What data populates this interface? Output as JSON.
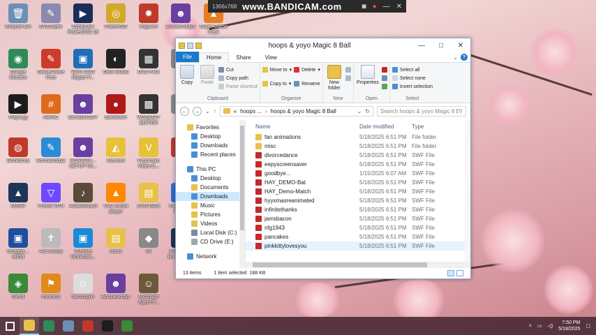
{
  "desktop": {
    "icons": [
      {
        "label": "Recycle Bin",
        "color": "#6b8fb5",
        "glyph": "🗑"
      },
      {
        "label": "DVDStyler",
        "color": "#8a8ab0",
        "glyph": "✎"
      },
      {
        "label": "CyberLink PowerDVD 18",
        "color": "#1b2d5b",
        "glyph": "▶"
      },
      {
        "label": "PowerISO",
        "color": "#d4a82a",
        "glyph": "◎"
      },
      {
        "label": "ImgBurn",
        "color": "#c0392b",
        "glyph": "✹"
      },
      {
        "label": "BonziBuddy3",
        "color": "#6a3fa0",
        "glyph": "☻"
      },
      {
        "label": "Super Game Pack",
        "color": "#e67e22",
        "glyph": "▲"
      },
      {
        "label": "Google Chrome",
        "color": "#2e8b57",
        "glyph": "◉"
      },
      {
        "label": "GameAware Free",
        "color": "#cc3b2b",
        "glyph": "✎"
      },
      {
        "label": "WinX DVD Ripper P...",
        "color": "#1e6fb8",
        "glyph": "▣"
      },
      {
        "label": "OBS Studio",
        "color": "#222",
        "glyph": "◐"
      },
      {
        "label": "DVD Flick",
        "color": "#333",
        "glyph": "▦"
      },
      {
        "label": "Flip",
        "color": "#888",
        "glyph": "◆"
      },
      {
        "label": "Playit.gg",
        "color": "#1c1c1c",
        "glyph": "▶"
      },
      {
        "label": "AdiIRC",
        "color": "#e06a1b",
        "glyph": "#"
      },
      {
        "label": "BonziBUDDY",
        "color": "#6a3fa0",
        "glyph": "☻"
      },
      {
        "label": "Bandicam",
        "color": "#b01818",
        "glyph": "●"
      },
      {
        "label": "WSQEDIT EDITOR",
        "color": "#333",
        "glyph": "▩"
      },
      {
        "label": "Idk",
        "color": "#888",
        "glyph": "◆"
      },
      {
        "label": "Bibbiiboby",
        "color": "#c0392b",
        "glyph": "◍"
      },
      {
        "label": "BonziBuddy2",
        "color": "#2c8bd6",
        "glyph": "✎"
      },
      {
        "label": "BONZIBU... SETUP WI...",
        "color": "#6a3fa0",
        "glyph": "☻"
      },
      {
        "label": "Maxwell",
        "color": "#e6c23a",
        "glyph": "◭"
      },
      {
        "label": "Freemake Video C...",
        "color": "#e6c23a",
        "glyph": "V"
      },
      {
        "label": "Mi...",
        "color": "#c0392b",
        "glyph": "■"
      },
      {
        "label": "MSSH",
        "color": "#1d3557",
        "glyph": "▲"
      },
      {
        "label": "Proton VPN",
        "color": "#6d4aff",
        "glyph": "▽"
      },
      {
        "label": "AudioWizard",
        "color": "#5a4a3a",
        "glyph": "♪"
      },
      {
        "label": "VLC media player",
        "color": "#ff8800",
        "glyph": "▲"
      },
      {
        "label": "DVD ISOs",
        "color": "#e8c14a",
        "glyph": "▤"
      },
      {
        "label": "Intellectual Player",
        "color": "#2c6fd6",
        "glyph": "▲"
      },
      {
        "label": "scrappa…tell5d",
        "color": "#1e4f9e",
        "glyph": "▣"
      },
      {
        "label": "Ace Buddy",
        "color": "#bbb",
        "glyph": "✝"
      },
      {
        "label": "VMware Workstati...",
        "color": "#1a8ad6",
        "glyph": "▣"
      },
      {
        "label": "chars",
        "color": "#e8c14a",
        "glyph": "▤"
      },
      {
        "label": "Mi",
        "color": "#888",
        "glyph": "◆"
      },
      {
        "label": "Ashampoo Burning S...",
        "color": "#1d3557",
        "glyph": "◉"
      },
      {
        "label": "blend",
        "color": "#3a8a3a",
        "glyph": "◈"
      },
      {
        "label": "minetest",
        "color": "#e08a1b",
        "glyph": "⚑"
      },
      {
        "label": "decompile",
        "color": "#ddd",
        "glyph": "☺"
      },
      {
        "label": "BonziBuddy1",
        "color": "#6a3fa0",
        "glyph": "☻"
      },
      {
        "label": "Microsoft Agent P...",
        "color": "#6b5a3a",
        "glyph": "☺"
      }
    ]
  },
  "bandicam": {
    "resolution": "1366x768",
    "brand": "www.BANDICAM.com",
    "controls": [
      "camera-icon",
      "record-icon",
      "minimize-icon",
      "close-icon"
    ]
  },
  "explorer": {
    "title": "hoops & yoyo Magic 8 Ball",
    "window_buttons": {
      "minimize": "—",
      "maximize": "□",
      "close": "✕"
    },
    "tabs": [
      {
        "label": "File",
        "style": "file"
      },
      {
        "label": "Home",
        "style": "active"
      },
      {
        "label": "Share",
        "style": ""
      },
      {
        "label": "View",
        "style": ""
      }
    ],
    "help_label": "?",
    "ribbon": {
      "clipboard": {
        "name": "Clipboard",
        "copy": "Copy",
        "paste": "Paste",
        "cut": "Cut",
        "copy_path": "Copy path",
        "paste_shortcut": "Paste shortcut"
      },
      "organize": {
        "name": "Organize",
        "move_to": "Move to",
        "copy_to": "Copy to",
        "delete": "Delete",
        "rename": "Rename"
      },
      "new": {
        "name": "New",
        "new_folder": "New folder"
      },
      "open": {
        "name": "Open",
        "properties": "Properties"
      },
      "select": {
        "name": "Select",
        "select_all": "Select all",
        "select_none": "Select none",
        "invert_selection": "Invert selection"
      }
    },
    "address": {
      "prefix": "«",
      "crumbs": [
        "hoops ...",
        "hoops & yoyo Magic 8 Ball"
      ],
      "search_placeholder": "Search hoops & yoyo Magic 8 Ball"
    },
    "navpane": {
      "quick_access": [
        {
          "label": "Favorites",
          "icon": "star-icon",
          "color": "#e8c14a"
        },
        {
          "label": "Desktop",
          "icon": "desktop-icon",
          "color": "#4a8fd6"
        },
        {
          "label": "Downloads",
          "icon": "downloads-icon",
          "color": "#4a8fd6"
        },
        {
          "label": "Recent places",
          "icon": "recent-icon",
          "color": "#4a8fd6"
        }
      ],
      "this_pc": [
        {
          "label": "This PC",
          "icon": "computer-icon",
          "color": "#4a8fd6"
        },
        {
          "label": "Desktop",
          "icon": "desktop-icon",
          "color": "#4a8fd6"
        },
        {
          "label": "Documents",
          "icon": "documents-icon",
          "color": "#e8c14a"
        },
        {
          "label": "Downloads",
          "icon": "downloads-icon",
          "color": "#4a8fd6"
        },
        {
          "label": "Music",
          "icon": "music-icon",
          "color": "#e8c14a"
        },
        {
          "label": "Pictures",
          "icon": "pictures-icon",
          "color": "#e8c14a"
        },
        {
          "label": "Videos",
          "icon": "videos-icon",
          "color": "#e8c14a"
        },
        {
          "label": "Local Disk (C:)",
          "icon": "disk-icon",
          "color": "#7a8a9a"
        },
        {
          "label": "CD Drive (E:)",
          "icon": "cd-drive-icon",
          "color": "#9aa"
        }
      ],
      "network": {
        "label": "Network",
        "icon": "network-icon",
        "color": "#4a8fd6"
      }
    },
    "columns": {
      "name": "Name",
      "date": "Date modified",
      "type": "Type"
    },
    "files": [
      {
        "name": "fan animations",
        "date": "5/18/2025 6:51 PM",
        "type": "File folder",
        "kind": "folder"
      },
      {
        "name": "misc",
        "date": "5/18/2025 6:51 PM",
        "type": "File folder",
        "kind": "folder"
      },
      {
        "name": "divorcedance",
        "date": "5/18/2025 6:51 PM",
        "type": "SWF File",
        "kind": "swf"
      },
      {
        "name": "eepyscreensaver",
        "date": "5/18/2025 6:51 PM",
        "type": "SWF File",
        "kind": "swf"
      },
      {
        "name": "goodbye...",
        "date": "1/15/2025 6:07 AM",
        "type": "SWF File",
        "kind": "swf"
      },
      {
        "name": "HAY_DEMO-Bat",
        "date": "5/18/2025 6:51 PM",
        "type": "SWF File",
        "kind": "swf"
      },
      {
        "name": "HAY_Demo-Match",
        "date": "5/18/2025 6:51 PM",
        "type": "SWF File",
        "kind": "swf"
      },
      {
        "name": "hyyxmasreanimated",
        "date": "5/18/2025 6:51 PM",
        "type": "SWF File",
        "kind": "swf"
      },
      {
        "name": "infinitethanks",
        "date": "5/18/2025 6:51 PM",
        "type": "SWF File",
        "kind": "swf"
      },
      {
        "name": "jamsbacon",
        "date": "5/18/2025 6:51 PM",
        "type": "SWF File",
        "kind": "swf"
      },
      {
        "name": "nfg1943",
        "date": "5/18/2025 6:51 PM",
        "type": "SWF File",
        "kind": "swf"
      },
      {
        "name": "pancakes",
        "date": "5/18/2025 6:51 PM",
        "type": "SWF File",
        "kind": "swf"
      },
      {
        "name": "pinkkittylovesyou",
        "date": "5/18/2025 6:51 PM",
        "type": "SWF File",
        "kind": "swf",
        "selected": true
      }
    ],
    "status": {
      "count": "13 items",
      "selection": "1 item selected",
      "size": "188 KB"
    }
  },
  "taskbar": {
    "icons": [
      {
        "name": "start-icon",
        "color": "#ffffff"
      },
      {
        "name": "file-explorer-icon",
        "color": "#e8c14a",
        "active": true
      },
      {
        "name": "chrome-icon",
        "color": "#2e8b57"
      },
      {
        "name": "control-panel-icon",
        "color": "#6b8fb5"
      },
      {
        "name": "speaker-app-icon",
        "color": "#c0392b"
      },
      {
        "name": "playit-icon",
        "color": "#1c1c1c"
      },
      {
        "name": "minecraft-icon",
        "color": "#3a8a3a"
      }
    ],
    "time": "7:50 PM",
    "date": "5/18/2025"
  },
  "colors": {
    "accent": "#1979ca",
    "selection": "#cce8ff",
    "swf": "#c62828",
    "folder": "#e8c14a"
  }
}
